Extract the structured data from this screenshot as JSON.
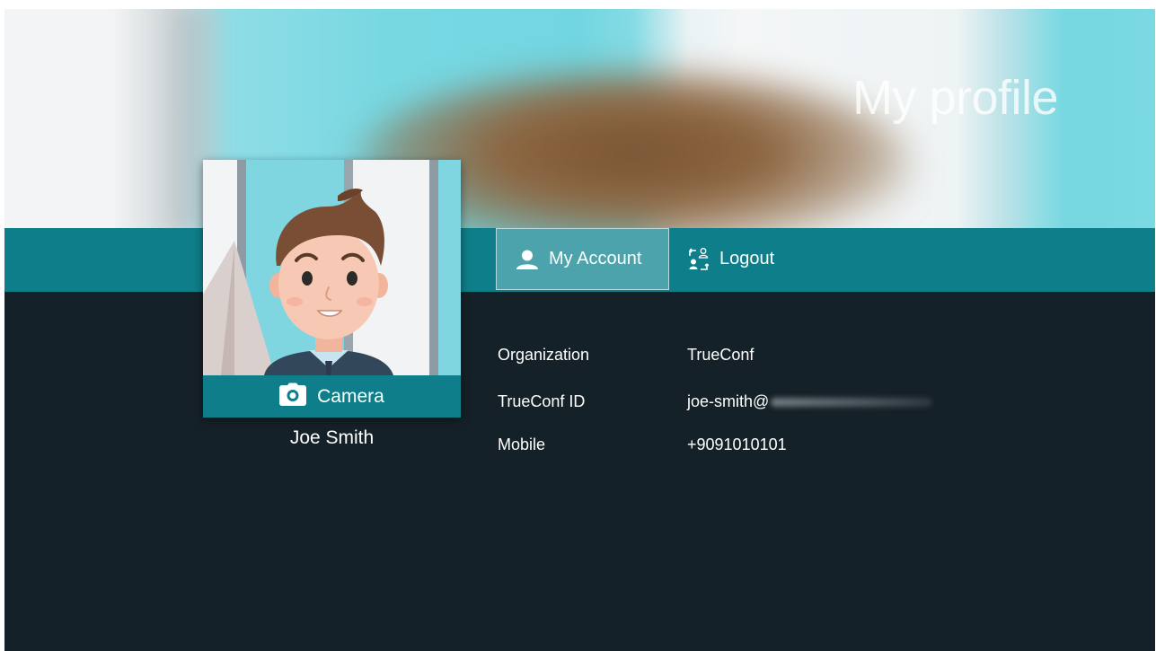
{
  "header": {
    "title": "My profile"
  },
  "tabs": [
    {
      "label": "My Account",
      "icon": "user-icon",
      "active": true
    },
    {
      "label": "Logout",
      "icon": "logout-icon",
      "active": false
    }
  ],
  "avatar": {
    "camera_label": "Camera",
    "camera_icon": "camera-icon"
  },
  "user": {
    "name": "Joe Smith"
  },
  "info": [
    {
      "label": "Organization",
      "value": "TrueConf"
    },
    {
      "label": "TrueConf ID",
      "value": "joe-smith@"
    },
    {
      "label": "Mobile",
      "value": "+9091010101"
    }
  ],
  "colors": {
    "accent": "#0e7f8a",
    "active_tab": "#4ca3ab",
    "background": "#152128",
    "banner": "#72d6e1"
  }
}
